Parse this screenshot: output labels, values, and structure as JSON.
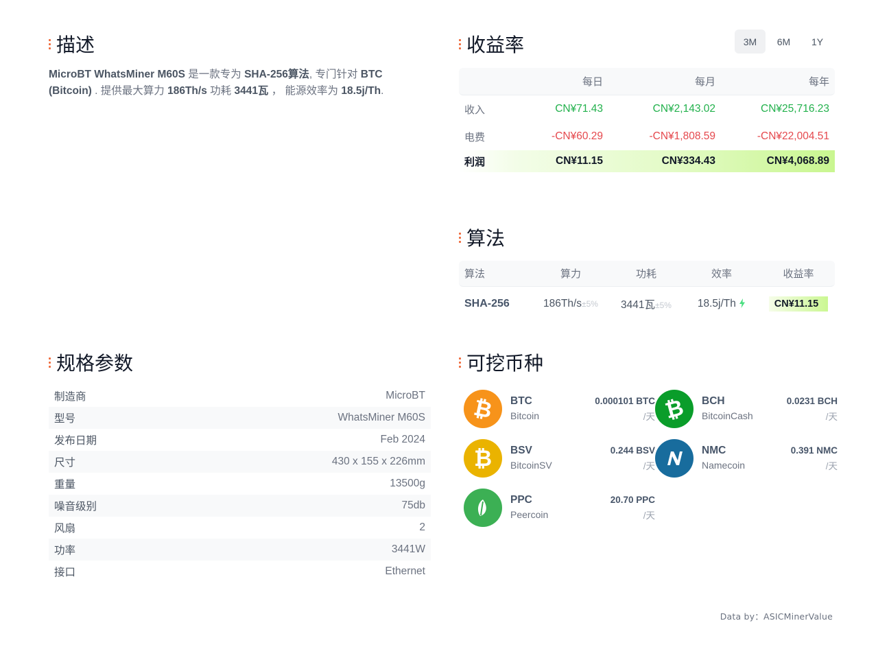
{
  "description": {
    "title": "描述",
    "parts": [
      {
        "text": "MicroBT WhatsMiner M60S",
        "bold": true
      },
      {
        "text": " 是一款专为 ",
        "bold": false
      },
      {
        "text": "SHA-256算法",
        "bold": true
      },
      {
        "text": ", 专门针对 ",
        "bold": false
      },
      {
        "text": "BTC (Bitcoin)",
        "bold": true
      },
      {
        "text": " . 提供最大算力 ",
        "bold": false
      },
      {
        "text": "186Th/s",
        "bold": true
      },
      {
        "text": " 功耗 ",
        "bold": false
      },
      {
        "text": "3441瓦",
        "bold": true
      },
      {
        "text": " ， 能源效率为 ",
        "bold": false
      },
      {
        "text": "18.5j/Th",
        "bold": true
      },
      {
        "text": ".",
        "bold": false
      }
    ]
  },
  "profitability": {
    "title": "收益率",
    "tabs": [
      "3M",
      "6M",
      "1Y"
    ],
    "active_tab": "3M",
    "columns": [
      "",
      "每日",
      "每月",
      "每年"
    ],
    "rows": [
      {
        "label": "收入",
        "values": [
          "CN¥71.43",
          "CN¥2,143.02",
          "CN¥25,716.23"
        ],
        "color": "green"
      },
      {
        "label": "电费",
        "values": [
          "-CN¥60.29",
          "-CN¥1,808.59",
          "-CN¥22,004.51"
        ],
        "color": "red"
      },
      {
        "label": "利润",
        "values": [
          "CN¥11.15",
          "CN¥334.43",
          "CN¥4,068.89"
        ],
        "color": "total"
      }
    ],
    "colors": {
      "income": "#22b14c",
      "cost": "#e5484d",
      "profit_highlight": "#c9f690"
    }
  },
  "algorithm": {
    "title": "算法",
    "columns": [
      "算法",
      "算力",
      "功耗",
      "效率",
      "收益率"
    ],
    "row": {
      "name": "SHA-256",
      "hashrate": "186Th/s",
      "hashrate_tol": "±5%",
      "power": "3441瓦",
      "power_tol": "±5%",
      "efficiency": "18.5j/Th",
      "profit": "CN¥11.15"
    }
  },
  "specs": {
    "title": "规格参数",
    "rows": [
      {
        "label": "制造商",
        "value": "MicroBT"
      },
      {
        "label": "型号",
        "value": "WhatsMiner M60S"
      },
      {
        "label": "发布日期",
        "value": "Feb 2024"
      },
      {
        "label": "尺寸",
        "value": "430 x 155 x 226mm"
      },
      {
        "label": "重量",
        "value": "13500g"
      },
      {
        "label": "噪音级别",
        "value": "75db"
      },
      {
        "label": "风扇",
        "value": "2"
      },
      {
        "label": "功率",
        "value": "3441W"
      },
      {
        "label": "接口",
        "value": "Ethernet"
      }
    ]
  },
  "coins": {
    "title": "可挖币种",
    "items": [
      {
        "symbol": "BTC",
        "name": "Bitcoin",
        "amount": "0.000101 BTC",
        "unit": "/天",
        "icon": "bitcoin-icon",
        "color": "#f7931a"
      },
      {
        "symbol": "BCH",
        "name": "BitcoinCash",
        "amount": "0.0231 BCH",
        "unit": "/天",
        "icon": "bitcoin-cash-icon",
        "color": "#0ac18e"
      },
      {
        "symbol": "BSV",
        "name": "BitcoinSV",
        "amount": "0.244 BSV",
        "unit": "/天",
        "icon": "bitcoin-sv-icon",
        "color": "#eab300"
      },
      {
        "symbol": "NMC",
        "name": "Namecoin",
        "amount": "0.391 NMC",
        "unit": "/天",
        "icon": "namecoin-icon",
        "color": "#186c9d"
      },
      {
        "symbol": "PPC",
        "name": "Peercoin",
        "amount": "20.70 PPC",
        "unit": "/天",
        "icon": "peercoin-icon",
        "color": "#3cb054"
      }
    ]
  },
  "footer": "Data by：ASICMinerValue"
}
